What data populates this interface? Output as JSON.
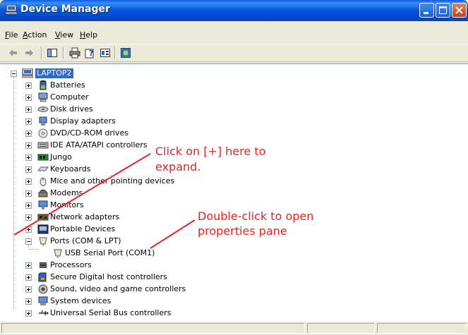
{
  "window": {
    "title": "Device Manager"
  },
  "menu": [
    {
      "pre": "",
      "u": "F",
      "post": "ile"
    },
    {
      "pre": "",
      "u": "A",
      "post": "ction"
    },
    {
      "pre": "",
      "u": "V",
      "post": "iew"
    },
    {
      "pre": "",
      "u": "H",
      "post": "elp"
    }
  ],
  "tree": {
    "root": "LAPTOP2",
    "items": [
      "Batteries",
      "Computer",
      "Disk drives",
      "Display adapters",
      "DVD/CD-ROM drives",
      "IDE ATA/ATAPI controllers",
      "Jungo",
      "Keyboards",
      "Mice and other pointing devices",
      "Modems",
      "Monitors",
      "Network adapters",
      "Portable Devices",
      "Ports (COM & LPT)",
      "USB Serial Port (COM1)",
      "Processors",
      "Secure Digital host controllers",
      "Sound, video and game controllers",
      "System devices",
      "Universal Serial Bus controllers"
    ]
  },
  "annotations": {
    "expand_line1": "Click on [+] here to",
    "expand_line2": "expand.",
    "open_line1": "Double-click to open",
    "open_line2": "properties pane"
  },
  "colors": {
    "annotation": "#e8221e",
    "selection": "#316ac5",
    "titlebar": "#0a58dc"
  }
}
